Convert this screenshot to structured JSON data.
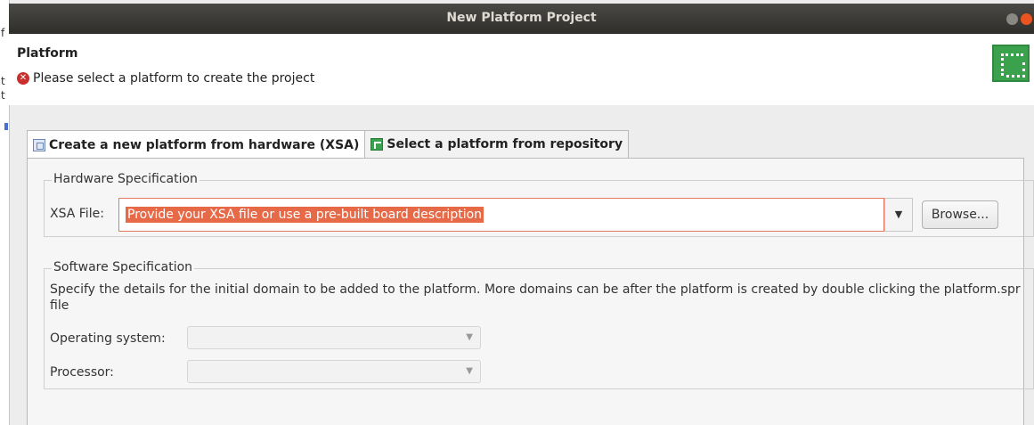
{
  "window": {
    "title": "New Platform Project"
  },
  "left_strip": {
    "chars": [
      "f",
      "t",
      "t"
    ]
  },
  "header": {
    "title": "Platform",
    "message": "Please select a platform to create the project",
    "error_icon": "error-icon",
    "logo_icon": "platform-logo-icon"
  },
  "tabs": [
    {
      "label": "Create a new platform from hardware (XSA)",
      "icon": "hardware-table-icon",
      "active": true
    },
    {
      "label": "Select a platform from repository",
      "icon": "repository-icon",
      "active": false
    }
  ],
  "hardware": {
    "legend": "Hardware Specification",
    "xsa_label": "XSA File:",
    "xsa_placeholder": "Provide your XSA file or use a pre-built board description",
    "xsa_value": "",
    "browse_label": "Browse..."
  },
  "software": {
    "legend": "Software Specification",
    "description": "Specify the details for the initial domain to be added to the platform. More domains can be after the platform is created by double clicking the platform.spr file",
    "os_label": "Operating system:",
    "os_value": "",
    "processor_label": "Processor:",
    "processor_value": ""
  },
  "colors": {
    "accent": "#e66a48",
    "logo": "#3aa14c",
    "error": "#c9302c"
  }
}
